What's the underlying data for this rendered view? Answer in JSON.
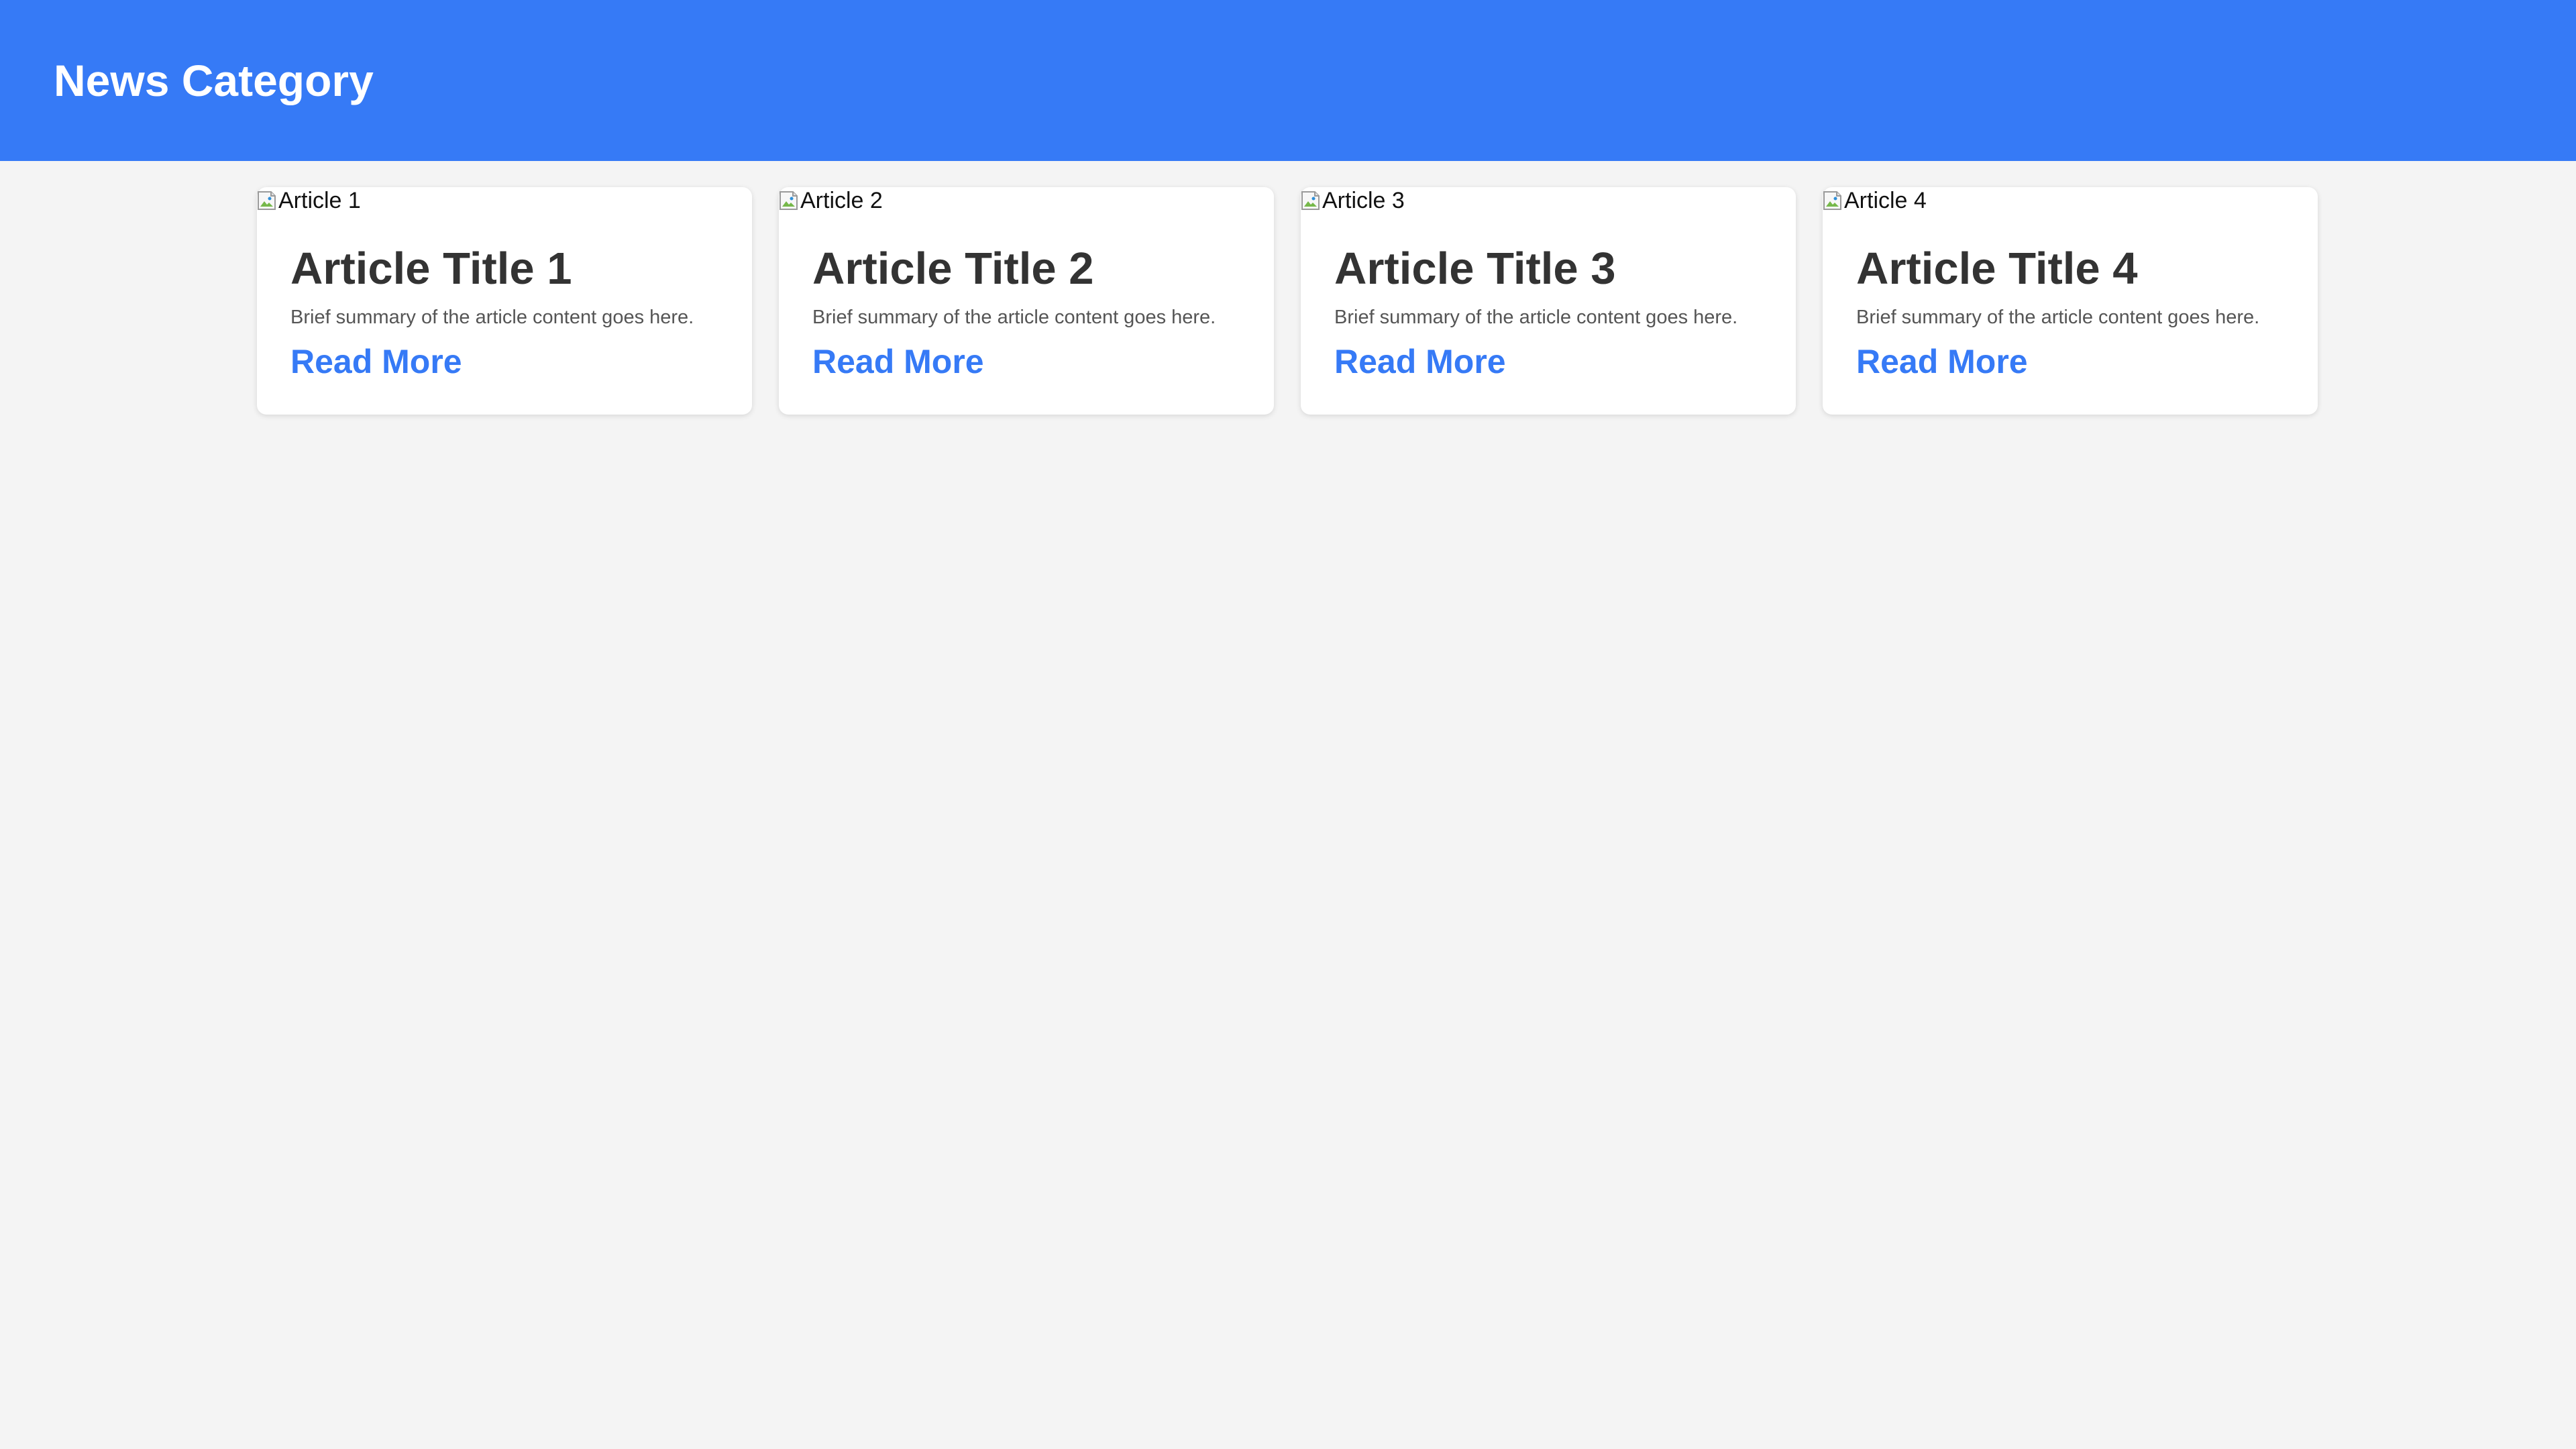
{
  "header": {
    "title": "News Category"
  },
  "colors": {
    "header_background": "#367af6",
    "page_background": "#f4f4f4",
    "card_background": "#ffffff",
    "title_text": "#333333",
    "summary_text": "#555555",
    "link_text": "#367af6"
  },
  "articles": [
    {
      "image_alt": "Article 1",
      "title": "Article Title 1",
      "summary": "Brief summary of the article content goes here.",
      "link_label": "Read More"
    },
    {
      "image_alt": "Article 2",
      "title": "Article Title 2",
      "summary": "Brief summary of the article content goes here.",
      "link_label": "Read More"
    },
    {
      "image_alt": "Article 3",
      "title": "Article Title 3",
      "summary": "Brief summary of the article content goes here.",
      "link_label": "Read More"
    },
    {
      "image_alt": "Article 4",
      "title": "Article Title 4",
      "summary": "Brief summary of the article content goes here.",
      "link_label": "Read More"
    }
  ],
  "icons": {
    "card_image": "broken-image-icon"
  }
}
